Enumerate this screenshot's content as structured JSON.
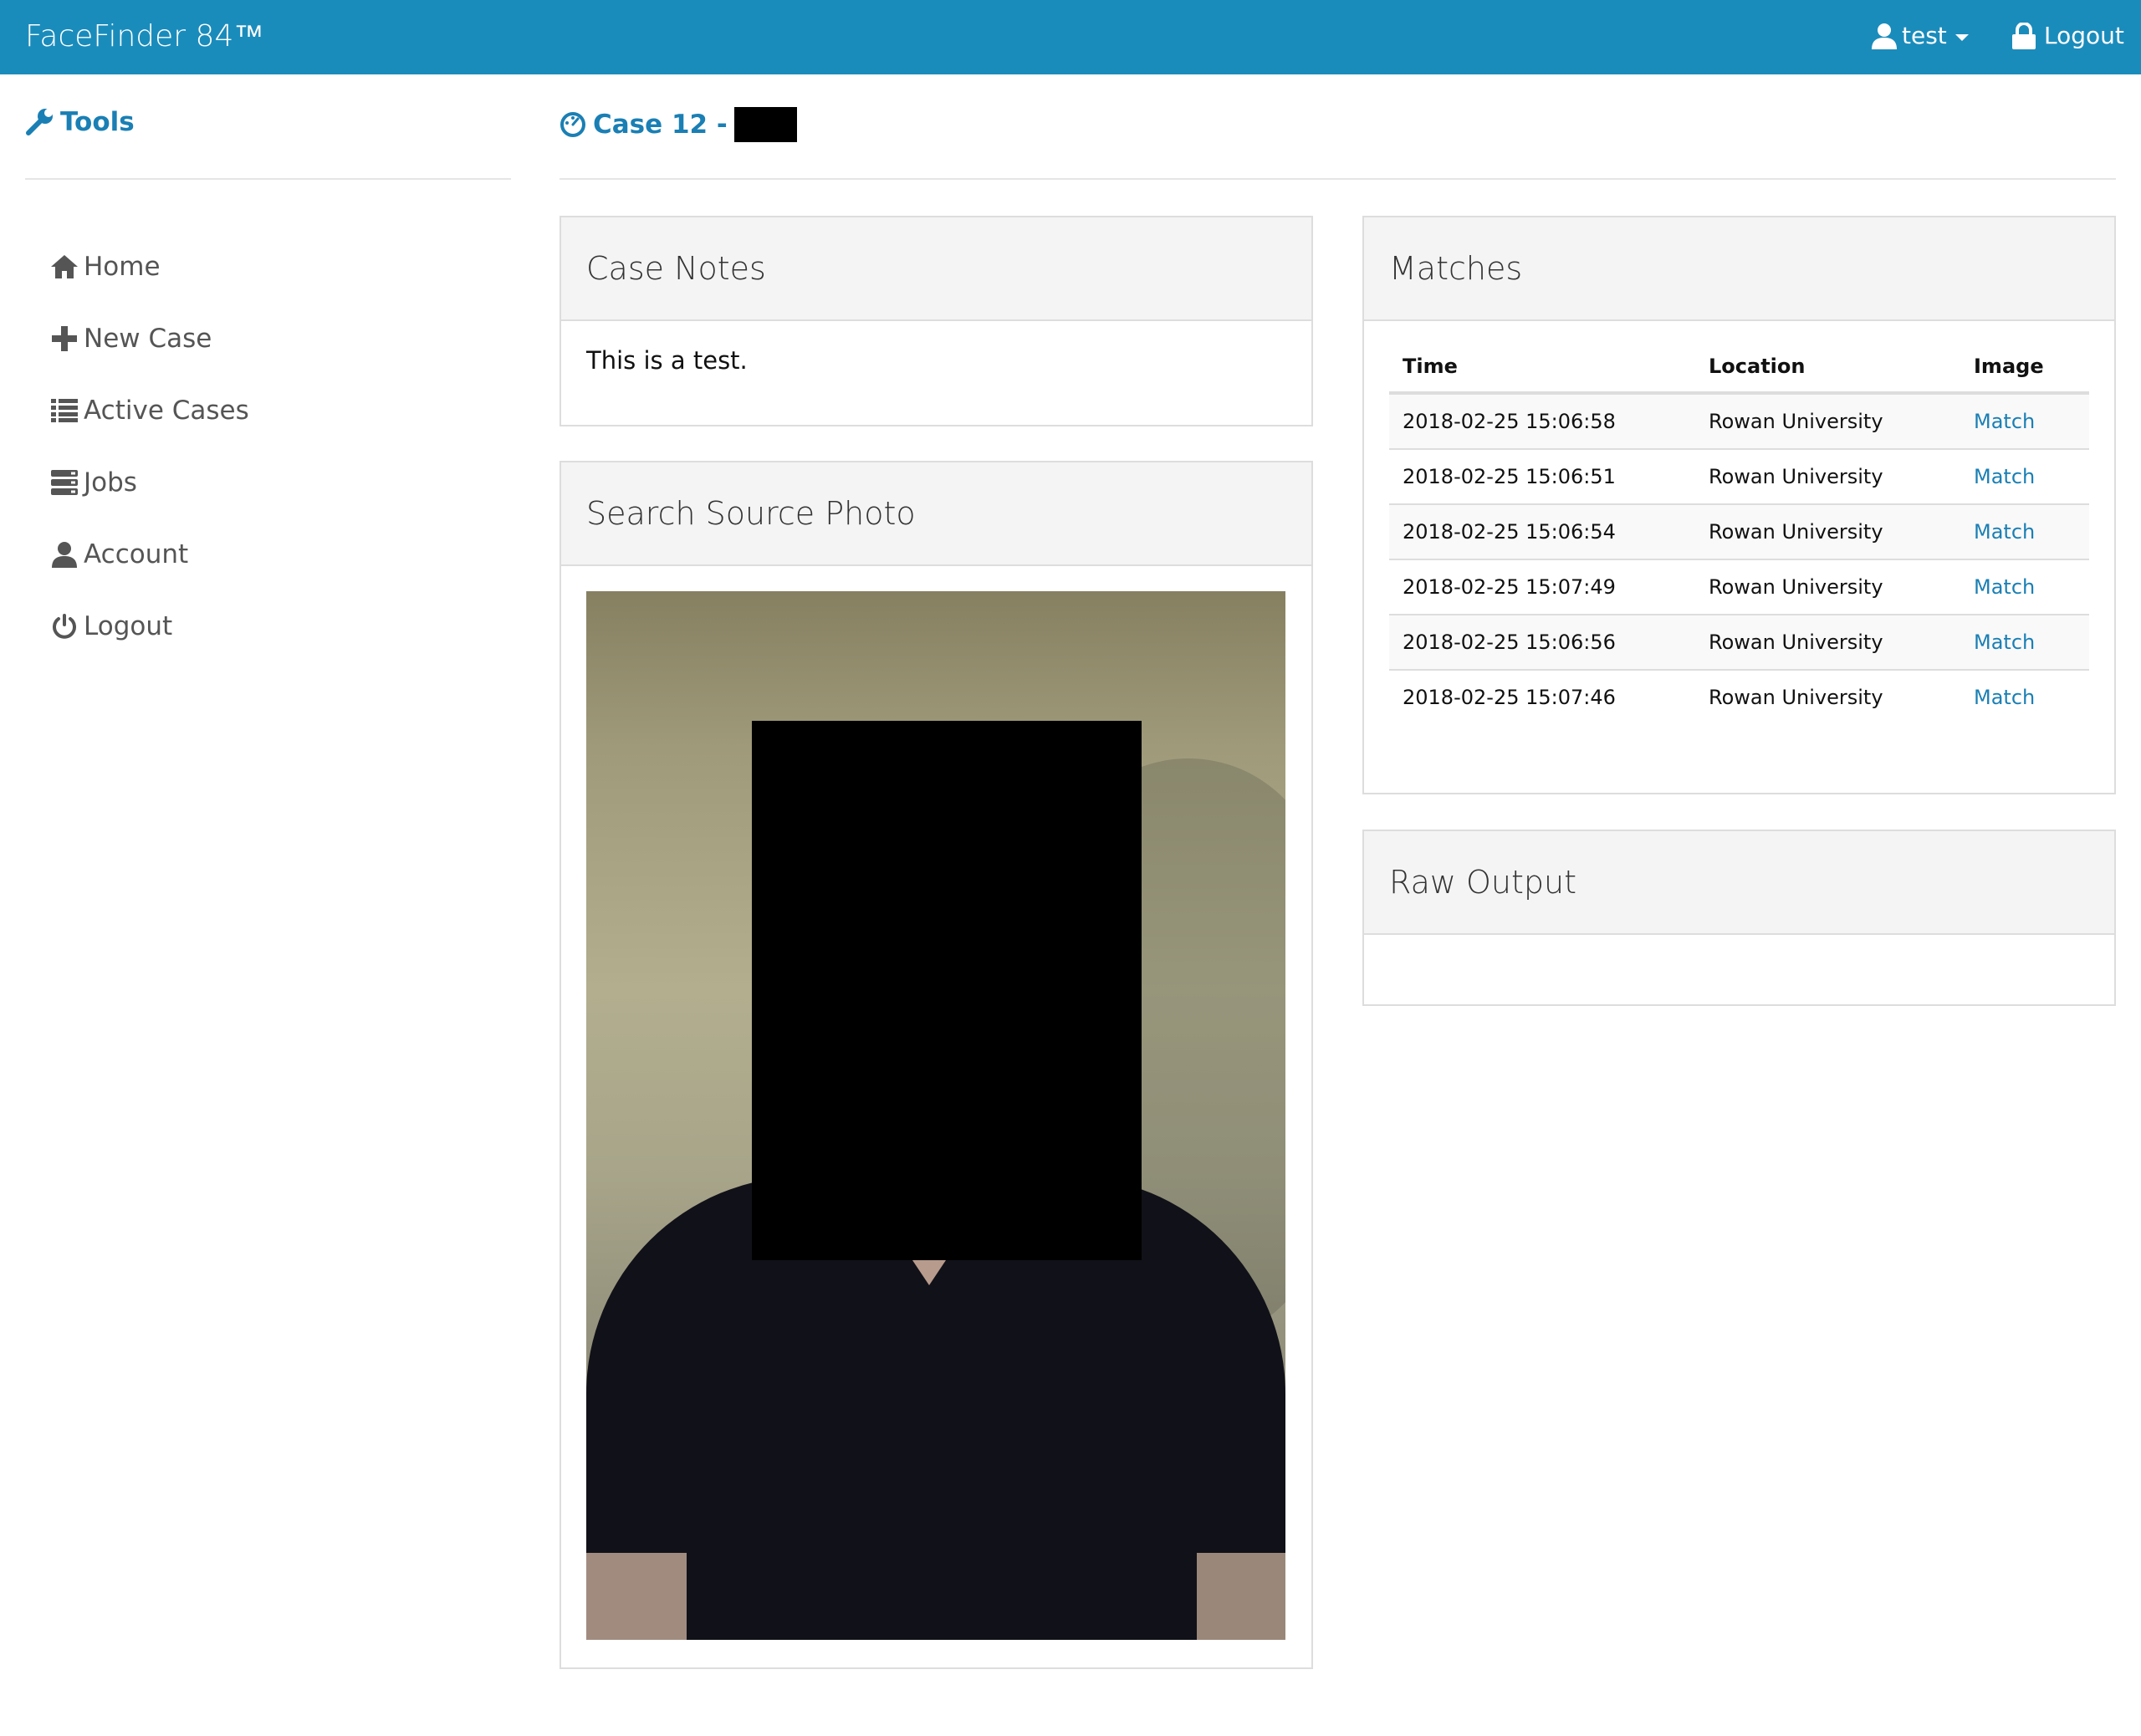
{
  "navbar": {
    "brand": "FaceFinder 84™",
    "user_label": "test",
    "logout_label": "Logout"
  },
  "sidebar": {
    "title": "Tools",
    "items": [
      {
        "label": "Home",
        "icon": "home-icon"
      },
      {
        "label": "New Case",
        "icon": "plus-icon"
      },
      {
        "label": "Active Cases",
        "icon": "list-icon"
      },
      {
        "label": "Jobs",
        "icon": "server-icon"
      },
      {
        "label": "Account",
        "icon": "user-icon"
      },
      {
        "label": "Logout",
        "icon": "power-icon"
      }
    ]
  },
  "page": {
    "title": "Case 12 -"
  },
  "case_notes": {
    "heading": "Case Notes",
    "text": "This is a test."
  },
  "source_photo": {
    "heading": "Search Source Photo"
  },
  "matches": {
    "heading": "Matches",
    "columns": [
      "Time",
      "Location",
      "Image"
    ],
    "rows": [
      {
        "time": "2018-02-25 15:06:58",
        "location": "Rowan University",
        "image": "Match"
      },
      {
        "time": "2018-02-25 15:06:51",
        "location": "Rowan University",
        "image": "Match"
      },
      {
        "time": "2018-02-25 15:06:54",
        "location": "Rowan University",
        "image": "Match"
      },
      {
        "time": "2018-02-25 15:07:49",
        "location": "Rowan University",
        "image": "Match"
      },
      {
        "time": "2018-02-25 15:06:56",
        "location": "Rowan University",
        "image": "Match"
      },
      {
        "time": "2018-02-25 15:07:46",
        "location": "Rowan University",
        "image": "Match"
      }
    ]
  },
  "raw_output": {
    "heading": "Raw Output",
    "text": ""
  },
  "colors": {
    "navbar": "#1a8cbc",
    "accent": "#1a7fb4"
  }
}
